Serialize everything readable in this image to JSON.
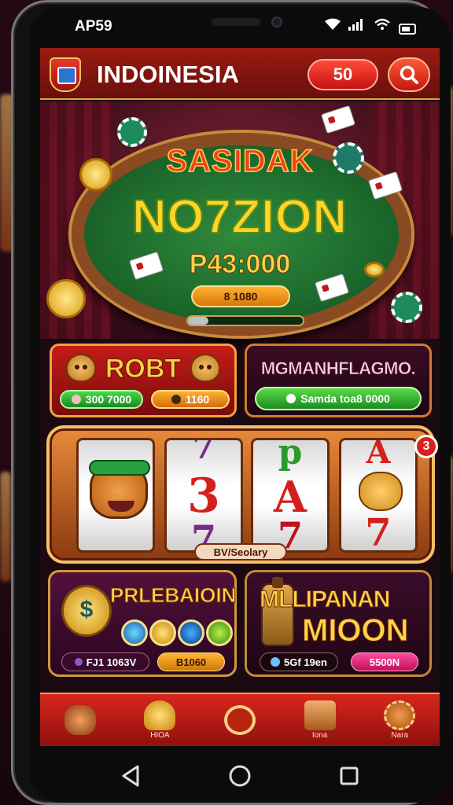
{
  "status": {
    "time": "AP59"
  },
  "header": {
    "title": "INDOINESIA",
    "coins": "50"
  },
  "hero": {
    "subtitle": "SASIDAK",
    "title": "NO7ZION",
    "prize": "P43:000",
    "pill": "8 1080",
    "progress": 0.18
  },
  "robot_card": {
    "title": "ROBT",
    "left_value": "300 7000",
    "right_value": "1160"
  },
  "dark_card": {
    "title": "MGMANHFLAGMO.",
    "button": "Samda toa8 0000"
  },
  "slot": {
    "reels": [
      {
        "symbols": [
          "",
          ""
        ]
      },
      {
        "symbols": [
          "7",
          "3",
          "7"
        ]
      },
      {
        "symbols": [
          "p",
          "A",
          "7"
        ]
      },
      {
        "symbols": [
          "A",
          "",
          "7"
        ]
      }
    ],
    "badge": "3",
    "label": "BV/Seolary"
  },
  "promo_left": {
    "title": "PRLEBAIOIN",
    "left": "FJ1 1063V",
    "right": "B1060"
  },
  "promo_right": {
    "title_1": "MLLIPANAN",
    "title_2": "MIOON",
    "left": "5Gf 19en",
    "right": "5500N"
  },
  "navbar": {
    "items": [
      {
        "label": ""
      },
      {
        "label": "HIOA"
      },
      {
        "label": ""
      },
      {
        "label": "Iona"
      },
      {
        "label": "Nara"
      }
    ]
  },
  "colors": {
    "header": "#9b1b12",
    "accent_gold": "#ffd44a",
    "nav": "#d8261c",
    "green_button": "#1c8a20"
  }
}
